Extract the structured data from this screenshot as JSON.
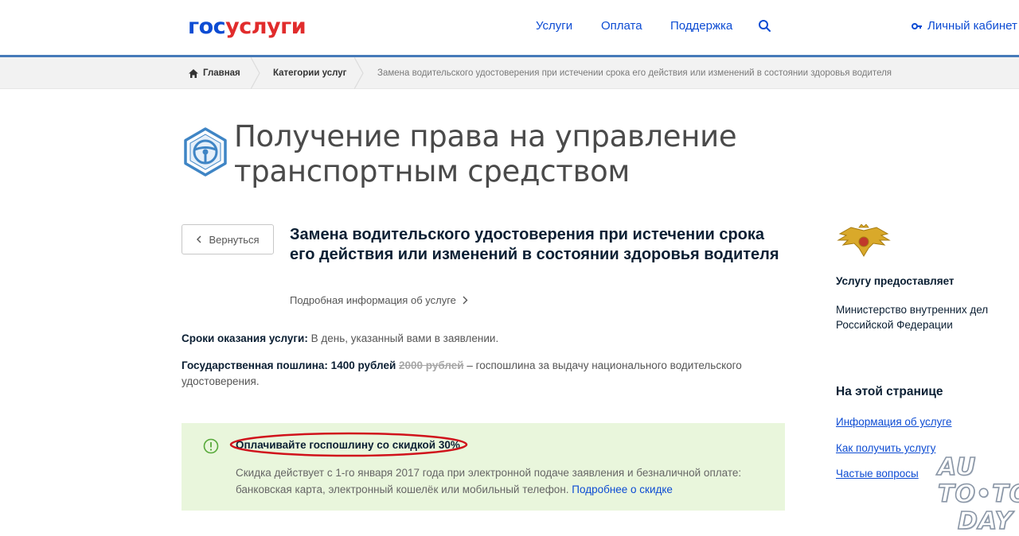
{
  "header": {
    "logo_part1": "гос",
    "logo_part2": "услуги",
    "nav": [
      "Услуги",
      "Оплата",
      "Поддержка"
    ],
    "cabinet": "Личный кабинет",
    "colors": {
      "brand_blue": "#0d4cd3",
      "brand_red": "#e12c2c"
    }
  },
  "breadcrumbs": {
    "home": "Главная",
    "category": "Категории услуг",
    "current": "Замена водительского удостоверения при истечении срока его действия или изменений в состоянии здоровья водителя"
  },
  "page": {
    "title": "Получение права на управление транспортным средством",
    "back_label": "Вернуться",
    "subtitle": "Замена водительского удостоверения при истечении срока его действия или изменений в состоянии здоровья водителя",
    "more_info": "Подробная информация об услуге",
    "terms_label": "Сроки оказания услуги:",
    "terms_value": " В день, указанный вами в заявлении.",
    "fee_label": "Государственная пошлина: 1400 рублей",
    "fee_old": "2000 рублей",
    "fee_rest": " – госпошлина за выдачу национального водительского удостоверения."
  },
  "discount": {
    "title": "Оплачивайте госпошлину со скидкой 30%",
    "text": "Скидка действует с 1-го января 2017 года при электронной подаче заявления и безналичной оплате: банковская карта, электронный кошелёк или мобильный телефон. ",
    "link": "Подробнее о скидке",
    "background": "#e9f6dc"
  },
  "sidebar": {
    "provider_heading": "Услугу предоставляет",
    "provider": "Министерство внутренних дел Российской Федерации",
    "onpage_heading": "На этой странице",
    "links": [
      "Информация об услуге",
      "Как получить услугу",
      "Частые вопросы"
    ]
  },
  "watermark": {
    "line1": "AU",
    "line2": "TO•TO",
    "line3": "DAY"
  }
}
